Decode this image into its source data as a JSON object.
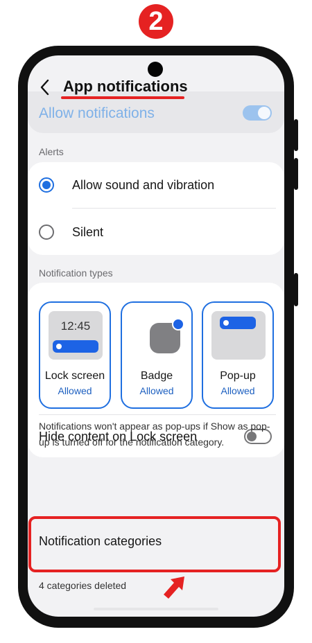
{
  "step_number": "2",
  "header": {
    "title": "App notifications"
  },
  "allow_notifications": {
    "label": "Allow notifications",
    "enabled": true
  },
  "alerts": {
    "section_label": "Alerts",
    "options": [
      {
        "label": "Allow sound and vibration",
        "selected": true
      },
      {
        "label": "Silent",
        "selected": false
      }
    ]
  },
  "notification_types": {
    "section_label": "Notification types",
    "tiles": [
      {
        "name": "Lock screen",
        "status": "Allowed",
        "clock": "12:45"
      },
      {
        "name": "Badge",
        "status": "Allowed"
      },
      {
        "name": "Pop-up",
        "status": "Allowed"
      }
    ]
  },
  "hide_content": {
    "label": "Hide content on Lock screen",
    "enabled": false
  },
  "info_text": "Notifications won't appear as pop-ups if Show as pop-up is turned off for the notification category.",
  "notification_categories": {
    "label": "Notification categories"
  },
  "deleted_categories": {
    "text": "4 categories deleted"
  },
  "colors": {
    "accent": "#1f6fe0",
    "annotation_red": "#e52222",
    "background": "#f2f2f4"
  }
}
